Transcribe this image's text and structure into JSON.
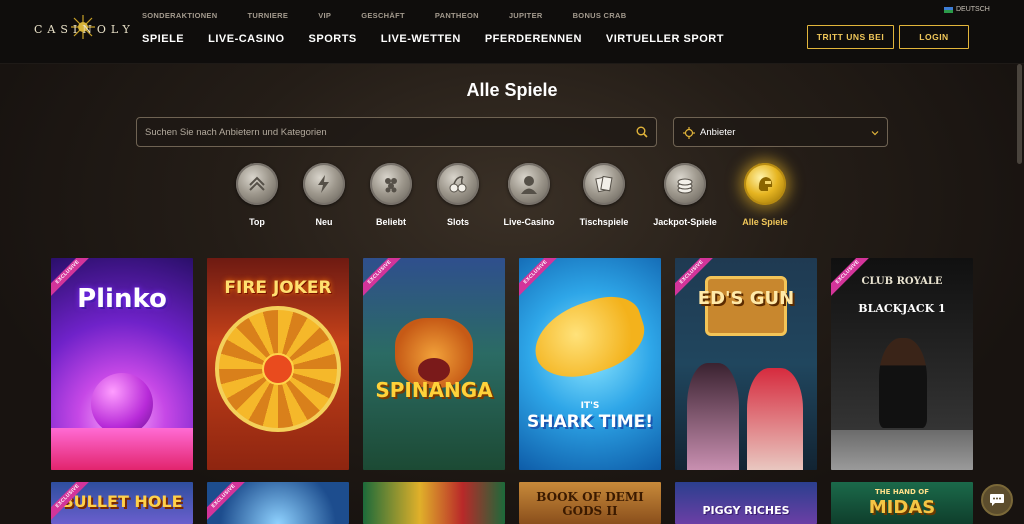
{
  "brand": {
    "logo_text": "CASINOLY"
  },
  "top_links": [
    "SONDERAKTIONEN",
    "TURNIERE",
    "VIP",
    "GESCHÄFT",
    "PANTHEON",
    "JUPITER",
    "BONUS CRAB"
  ],
  "language": "DEUTSCH",
  "main_nav": [
    "SPIELE",
    "LIVE-CASINO",
    "SPORTS",
    "LIVE-WETTEN",
    "PFERDERENNEN",
    "VIRTUELLER SPORT"
  ],
  "header_buttons": {
    "register": "TRITT UNS BEI",
    "login": "LOGIN"
  },
  "page_title": "Alle Spiele",
  "search": {
    "placeholder": "Suchen Sie nach Anbietern und Kategorien",
    "value": ""
  },
  "provider_select": {
    "label": "Anbieter"
  },
  "categories": [
    {
      "label": "Top",
      "icon": "crown-chevron-icon"
    },
    {
      "label": "Neu",
      "icon": "lightning-icon"
    },
    {
      "label": "Beliebt",
      "icon": "grapes-icon"
    },
    {
      "label": "Slots",
      "icon": "cherries-icon"
    },
    {
      "label": "Live-Casino",
      "icon": "bust-icon"
    },
    {
      "label": "Tischspiele",
      "icon": "cards-icon"
    },
    {
      "label": "Jackpot-Spiele",
      "icon": "coins-icon"
    },
    {
      "label": "Alle Spiele",
      "icon": "helmet-icon",
      "active": true
    }
  ],
  "games_row1": [
    {
      "title": "Plinko",
      "exclusive": true
    },
    {
      "title": "FIRE JOKER",
      "exclusive": false
    },
    {
      "title": "SPINANGA",
      "exclusive": true
    },
    {
      "title": "SHARK TIME!",
      "subtitle": "IT'S",
      "exclusive": true
    },
    {
      "title": "ED'S GUN",
      "exclusive": true
    },
    {
      "title": "BLACKJACK 1",
      "subtitle": "CLUB ROYALE",
      "exclusive": true
    }
  ],
  "games_row2": [
    {
      "title": "BULLET HOLE",
      "exclusive": true
    },
    {
      "title": "",
      "exclusive": true
    },
    {
      "title": "",
      "exclusive": false
    },
    {
      "title": "BOOK OF DEMI GODS II",
      "exclusive": false
    },
    {
      "title": "PIGGY RICHES",
      "exclusive": false
    },
    {
      "title": "MIDAS",
      "subtitle": "THE HAND OF",
      "exclusive": false
    }
  ],
  "badge_label": "EXCLUSIVE",
  "colors": {
    "accent": "#e2b53b",
    "background": "#161210",
    "badge": "#d3349a"
  }
}
